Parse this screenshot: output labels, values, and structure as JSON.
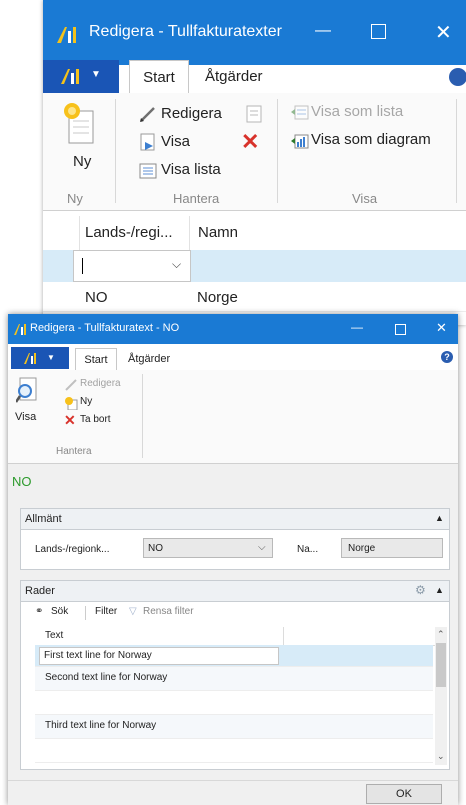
{
  "back_window": {
    "title": "Redigera - Tullfakturatexter",
    "tabs": {
      "start": "Start",
      "atgarder": "Åtgärder"
    },
    "ribbon": {
      "ny": "Ny",
      "redigera": "Redigera",
      "visa": "Visa",
      "visa_lista": "Visa lista",
      "visa_som_lista": "Visa som lista",
      "visa_som_diagram": "Visa som diagram",
      "groups": {
        "ny": "Ny",
        "hantera": "Hantera",
        "visa": "Visa"
      }
    },
    "grid": {
      "columns": [
        "Lands-/regi...",
        "Namn"
      ],
      "rows": [
        {
          "code": "NO",
          "name": "Norge"
        }
      ]
    }
  },
  "front_window": {
    "title": "Redigera - Tullfakturatext - NO",
    "tabs": {
      "start": "Start",
      "atgarder": "Åtgärder"
    },
    "ribbon": {
      "visa": "Visa",
      "redigera": "Redigera",
      "ny": "Ny",
      "ta_bort": "Ta bort",
      "group_hantera": "Hantera"
    },
    "record_caption": "NO",
    "allmant": {
      "title": "Allmänt",
      "region_label": "Lands-/regionk...",
      "region_value": "NO",
      "name_label": "Na...",
      "name_value": "Norge"
    },
    "rader": {
      "title": "Rader",
      "toolbar": {
        "sok": "Sök",
        "filter": "Filter",
        "rensa_filter": "Rensa filter"
      },
      "column": "Text",
      "rows": [
        "First text line for Norway",
        "Second text line for Norway",
        "",
        "Third text line for Norway",
        ""
      ]
    },
    "ok_button": "OK"
  },
  "colors": {
    "titlebar": "#1a7ad4",
    "app_menu": "#1a55b5",
    "selected_row": "#d7ebf8",
    "record_caption": "#2c9a2c",
    "delete_x": "#d8322b"
  },
  "icons": [
    "app-logo-icon",
    "new-document-icon",
    "pencil-icon",
    "view-icon",
    "delete-x-icon",
    "list-icon",
    "chart-icon",
    "magnifier-view-icon",
    "binoculars-icon",
    "filter-icon",
    "help-icon",
    "gear-icon",
    "chevron-up-icon"
  ]
}
